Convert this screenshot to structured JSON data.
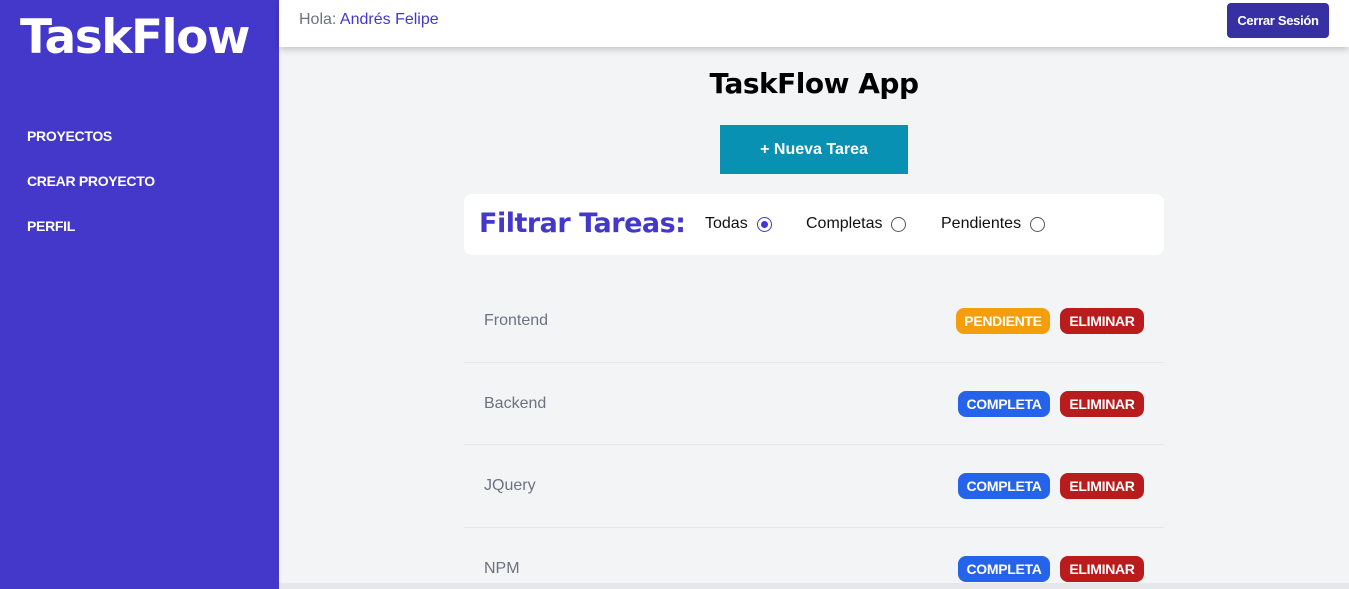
{
  "app": {
    "logo": "TaskFlow",
    "title": "TaskFlow App"
  },
  "sidebar": {
    "items": [
      {
        "label": "PROYECTOS"
      },
      {
        "label": "CREAR PROYECTO"
      },
      {
        "label": "PERFIL"
      }
    ]
  },
  "header": {
    "greeting": "Hola: ",
    "user_name": "Andrés Felipe",
    "logout_label": "Cerrar Sesión"
  },
  "actions": {
    "new_task_label": "+ Nueva Tarea"
  },
  "filter": {
    "label": "Filtrar Tareas:",
    "options": [
      {
        "label": "Todas",
        "checked": true
      },
      {
        "label": "Completas",
        "checked": false
      },
      {
        "label": "Pendientes",
        "checked": false
      }
    ]
  },
  "tasks": [
    {
      "name": "Frontend",
      "status": "PENDIENTE",
      "delete_label": "ELIMINAR"
    },
    {
      "name": "Backend",
      "status": "COMPLETA",
      "delete_label": "ELIMINAR"
    },
    {
      "name": "JQuery",
      "status": "COMPLETA",
      "delete_label": "ELIMINAR"
    },
    {
      "name": "NPM",
      "status": "COMPLETA",
      "delete_label": "ELIMINAR"
    }
  ],
  "colors": {
    "primary": "#4338ca",
    "accent": "#0891b2",
    "pending": "#f59e0b",
    "complete": "#2563eb",
    "danger": "#b91c1c"
  }
}
